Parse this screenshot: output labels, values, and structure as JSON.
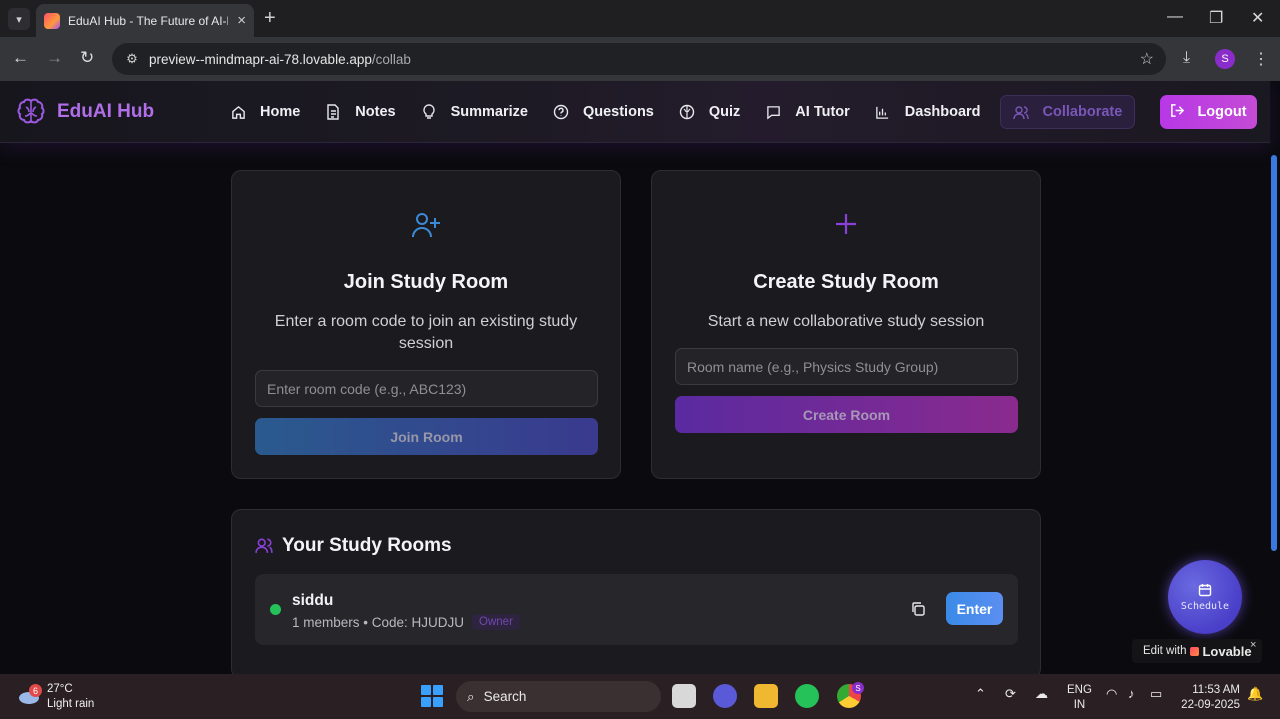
{
  "browser": {
    "tab_title": "EduAI Hub - The Future of AI-P",
    "url_host": "preview--mindmapr-ai-78.lovable.app",
    "url_path": "/collab",
    "profile_initial": "S"
  },
  "nav": {
    "brand": "EduAI Hub",
    "items": [
      {
        "label": "Home",
        "icon": "home-icon"
      },
      {
        "label": "Notes",
        "icon": "file-icon"
      },
      {
        "label": "Summarize",
        "icon": "lightbulb-icon"
      },
      {
        "label": "Questions",
        "icon": "help-circle-icon"
      },
      {
        "label": "Quiz",
        "icon": "brain-icon"
      },
      {
        "label": "AI Tutor",
        "icon": "message-icon"
      },
      {
        "label": "Dashboard",
        "icon": "bar-chart-icon"
      },
      {
        "label": "Collaborate",
        "icon": "users-icon"
      }
    ],
    "active": "Collaborate",
    "logout": "Logout"
  },
  "join": {
    "title": "Join Study Room",
    "desc": "Enter a room code to join an existing study session",
    "placeholder": "Enter room code (e.g., ABC123)",
    "button": "Join Room"
  },
  "create": {
    "title": "Create Study Room",
    "desc": "Start a new collaborative study session",
    "placeholder": "Room name (e.g., Physics Study Group)",
    "button": "Create Room"
  },
  "rooms": {
    "title": "Your Study Rooms",
    "items": [
      {
        "name": "siddu",
        "meta": "1 members • Code: HJUDJU",
        "badge": "Owner",
        "enter": "Enter",
        "online": true
      }
    ]
  },
  "floating": {
    "schedule": "Schedule",
    "lovable_prefix": "Edit with",
    "lovable_brand": "Lovable",
    "close": "×"
  },
  "taskbar": {
    "weather_badge": "6",
    "temp": "27°C",
    "condition": "Light rain",
    "search": "Search",
    "lang1": "ENG",
    "lang2": "IN",
    "time": "11:53 AM",
    "date": "22-09-2025",
    "chrome_badge": "S"
  },
  "colors": {
    "accent": "#b06ee8",
    "logout": "#c044dc",
    "online": "#25c25a",
    "enter": "#4a8cec"
  }
}
